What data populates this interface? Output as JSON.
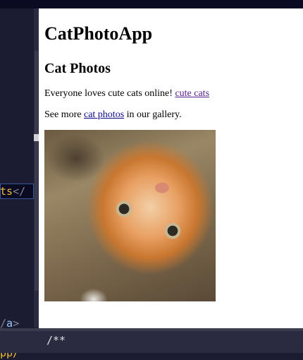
{
  "editor": {
    "lines": [
      {
        "text_a": "ts",
        "text_b": "</"
      },
      {
        "text_a": "/",
        "text_b": "a",
        "text_c": ">"
      },
      {
        "text_a": "pp/"
      }
    ],
    "bottom_code": "/**"
  },
  "preview": {
    "heading": "CatPhotoApp",
    "subheading": "Cat Photos",
    "para1_text": "Everyone loves cute cats online! ",
    "para1_link": "cute cats",
    "para2_prefix": "See more ",
    "para2_link": "cat photos",
    "para2_suffix": " in our gallery.",
    "image_alt": "kitten lying on its back, upside-down face"
  },
  "colors": {
    "editor_bg": "#1b1b32",
    "preview_bg": "#ffffff",
    "visited_link": "#551a8b",
    "link": "#0b0b8c"
  }
}
